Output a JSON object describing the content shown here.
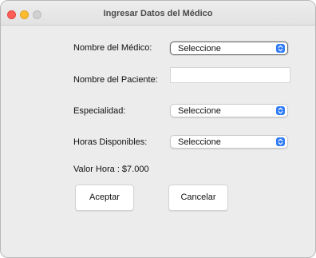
{
  "window": {
    "title": "Ingresar Datos del Médico",
    "controls": [
      "close",
      "minimize",
      "maximize"
    ]
  },
  "form": {
    "medico_label": "Nombre del Médico:",
    "medico_value": "Seleccione",
    "paciente_label": "Nombre del Paciente:",
    "paciente_value": "",
    "especialidad_label": "Especialidad:",
    "especialidad_value": "Seleccione",
    "horas_label": "Horas Disponibles:",
    "horas_value": "Seleccione",
    "valor_hora": "Valor Hora : $7.000"
  },
  "buttons": {
    "accept_label": "Aceptar",
    "cancel_label": "Cancelar"
  },
  "colors": {
    "close": "#ff5f57",
    "minimize": "#febc2e",
    "maximize": "#d0d0d0",
    "accent": "#2f7cf6"
  }
}
